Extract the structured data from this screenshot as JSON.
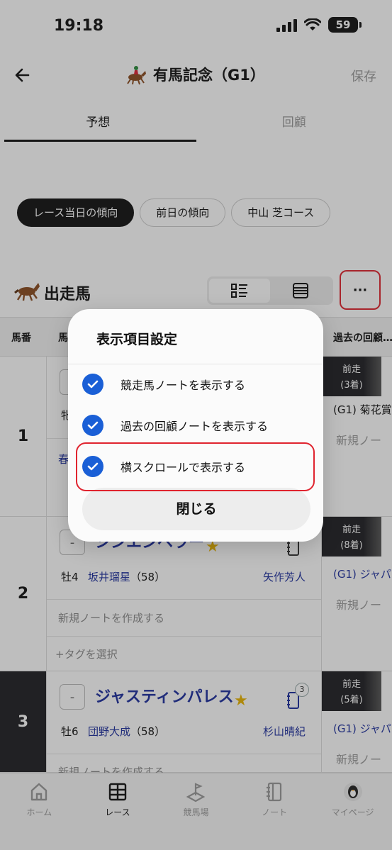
{
  "status": {
    "time": "19:18",
    "battery": "59"
  },
  "header": {
    "title": "有馬記念（G1）",
    "save_label": "保存"
  },
  "tabs": [
    {
      "label": "予想",
      "active": true
    },
    {
      "label": "回顧",
      "active": false
    }
  ],
  "chips": [
    {
      "label": "レース当日の傾向",
      "active": true
    },
    {
      "label": "前日の傾向",
      "active": false
    },
    {
      "label": "中山 芝コース",
      "active": false
    }
  ],
  "section": {
    "title": "出走馬"
  },
  "table": {
    "headers": {
      "number": "馬番",
      "horse": "馬",
      "past": "過去の回顧…"
    },
    "rows": [
      {
        "number": "1",
        "sex_age": "牝",
        "past_badge_line1": "前走",
        "past_badge_line2": "(3着)",
        "past_race": "(G1) 菊花賞",
        "past_note": "新規ノー",
        "tag_prefix": "春"
      },
      {
        "number": "2",
        "minus": "-",
        "name": "シンエンペラー",
        "sex_age": "牡4",
        "jockey": "坂井瑠星",
        "weight": "（58）",
        "trainer": "矢作芳人",
        "note_create": "新規ノートを作成する",
        "tag_select": "+タグを選択",
        "past_badge_line1": "前走",
        "past_badge_line2": "(8着)",
        "past_race": "(G1) ジャパ",
        "past_note": "新規ノー"
      },
      {
        "number": "3",
        "minus": "-",
        "name": "ジャスティンパレス",
        "note_count": "3",
        "sex_age": "牡6",
        "jockey": "団野大成",
        "weight": "（58）",
        "trainer": "杉山晴紀",
        "note_create": "新規ノートを作成する",
        "past_badge_line1": "前走",
        "past_badge_line2": "(5着)",
        "past_race": "(G1) ジャパ",
        "past_note": "新規ノー"
      }
    ]
  },
  "modal": {
    "title": "表示項目設定",
    "options": [
      {
        "label": "競走馬ノートを表示する",
        "checked": true
      },
      {
        "label": "過去の回顧ノートを表示する",
        "checked": true
      },
      {
        "label": "横スクロールで表示する",
        "checked": true
      }
    ],
    "close_label": "閉じる"
  },
  "bottom_nav": [
    {
      "label": "ホーム",
      "icon": "home-icon",
      "active": false
    },
    {
      "label": "レース",
      "icon": "table-icon",
      "active": true
    },
    {
      "label": "競馬場",
      "icon": "course-icon",
      "active": false
    },
    {
      "label": "ノート",
      "icon": "notebook-icon",
      "active": false
    },
    {
      "label": "マイページ",
      "icon": "avatar-icon",
      "active": false
    }
  ],
  "colors": {
    "accent_blue": "#1d2f9e",
    "check_blue": "#1a5fd6",
    "highlight_red": "#e0242f",
    "star": "#e8b400"
  }
}
